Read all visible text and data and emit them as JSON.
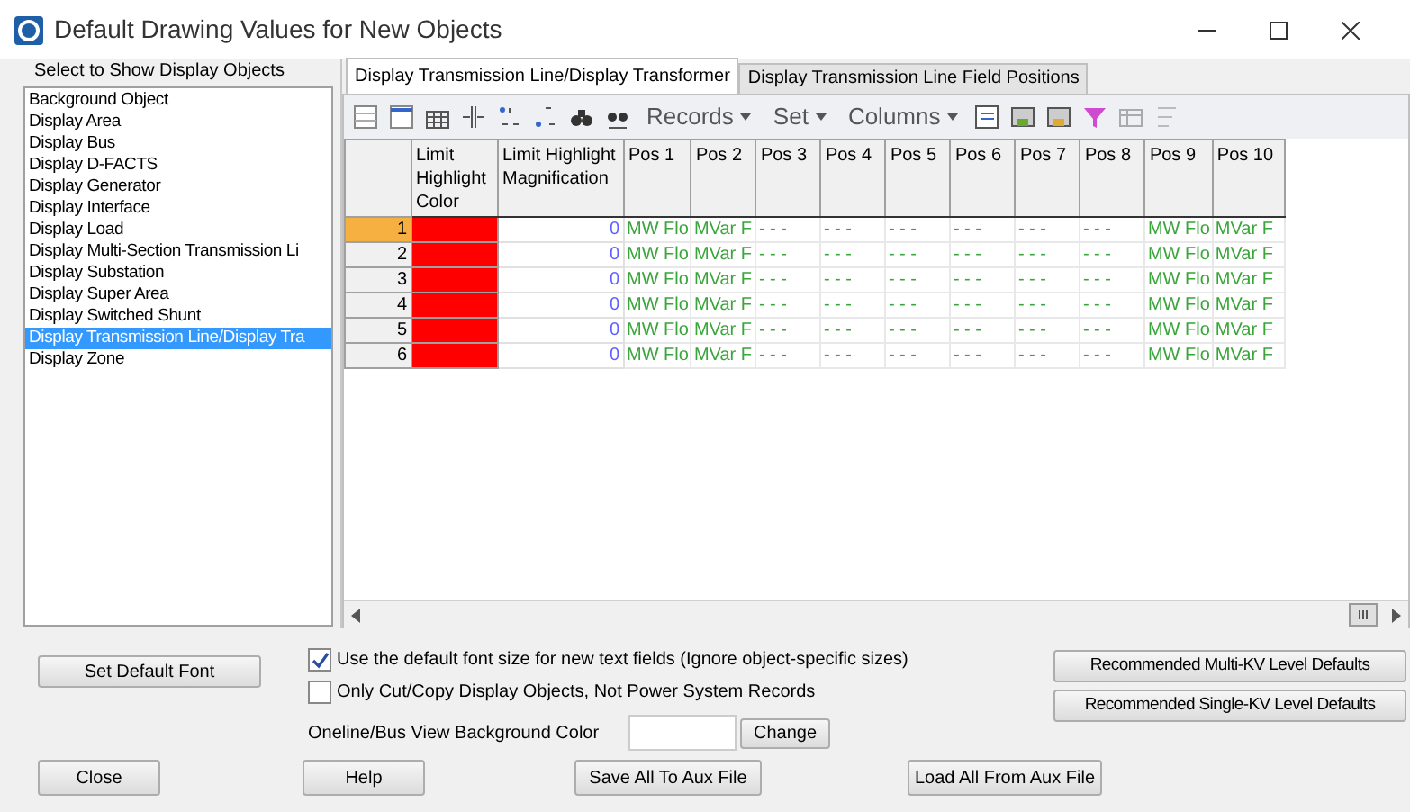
{
  "window": {
    "title": "Default Drawing Values for New Objects"
  },
  "object_list": {
    "title": "Select to Show Display Objects",
    "items": [
      {
        "label": "Background Object",
        "selected": false
      },
      {
        "label": "Display Area",
        "selected": false
      },
      {
        "label": "Display Bus",
        "selected": false
      },
      {
        "label": "Display D-FACTS",
        "selected": false
      },
      {
        "label": "Display Generator",
        "selected": false
      },
      {
        "label": "Display Interface",
        "selected": false
      },
      {
        "label": "Display Load",
        "selected": false
      },
      {
        "label": "Display Multi-Section Transmission Li",
        "selected": false
      },
      {
        "label": "Display Substation",
        "selected": false
      },
      {
        "label": "Display Super Area",
        "selected": false
      },
      {
        "label": "Display Switched Shunt",
        "selected": false
      },
      {
        "label": "Display Transmission Line/Display Tra",
        "selected": true
      },
      {
        "label": "Display Zone",
        "selected": false
      }
    ]
  },
  "tabs": [
    {
      "label": "Display Transmission Line/Display Transformer",
      "selected": true
    },
    {
      "label": "Display Transmission Line Field Positions",
      "selected": false
    }
  ],
  "toolbar": {
    "menus": [
      "Records",
      "Set",
      "Columns"
    ]
  },
  "table": {
    "columns": [
      "Limit Highlight Color",
      "Limit Highlight Magnification",
      "Pos 1",
      "Pos 2",
      "Pos 3",
      "Pos 4",
      "Pos 5",
      "Pos 6",
      "Pos 7",
      "Pos 8",
      "Pos 9",
      "Pos 10"
    ],
    "rows": [
      {
        "number": "1",
        "selected": true,
        "color": "#ff0000",
        "cells": [
          "",
          "0",
          "MW Flo",
          "MVar F",
          "- - -",
          "- - -",
          "- - -",
          "- - -",
          "- - -",
          "- - -",
          "MW Flo",
          "MVar F"
        ]
      },
      {
        "number": "2",
        "selected": false,
        "color": "#ff0000",
        "cells": [
          "",
          "0",
          "MW Flo",
          "MVar F",
          "- - -",
          "- - -",
          "- - -",
          "- - -",
          "- - -",
          "- - -",
          "MW Flo",
          "MVar F"
        ]
      },
      {
        "number": "3",
        "selected": false,
        "color": "#ff0000",
        "cells": [
          "",
          "0",
          "MW Flo",
          "MVar F",
          "- - -",
          "- - -",
          "- - -",
          "- - -",
          "- - -",
          "- - -",
          "MW Flo",
          "MVar F"
        ]
      },
      {
        "number": "4",
        "selected": false,
        "color": "#ff0000",
        "cells": [
          "",
          "0",
          "MW Flo",
          "MVar F",
          "- - -",
          "- - -",
          "- - -",
          "- - -",
          "- - -",
          "- - -",
          "MW Flo",
          "MVar F"
        ]
      },
      {
        "number": "5",
        "selected": false,
        "color": "#ff0000",
        "cells": [
          "",
          "0",
          "MW Flo",
          "MVar F",
          "- - -",
          "- - -",
          "- - -",
          "- - -",
          "- - -",
          "- - -",
          "MW Flo",
          "MVar F"
        ]
      },
      {
        "number": "6",
        "selected": false,
        "color": "#ff0000",
        "cells": [
          "",
          "0",
          "MW Flo",
          "MVar F",
          "- - -",
          "- - -",
          "- - -",
          "- - -",
          "- - -",
          "- - -",
          "MW Flo",
          "MVar F"
        ]
      }
    ]
  },
  "options": {
    "set_font_button": "Set Default Font",
    "checkboxes": [
      {
        "label": "Use the default font size for new text fields (Ignore object-specific sizes)",
        "checked": true
      },
      {
        "label": "Only Cut/Copy Display Objects, Not Power System Records",
        "checked": false
      }
    ],
    "background_color_label": "Oneline/Bus View Background Color",
    "change_button": "Change",
    "kv_buttons": [
      "Recommended Multi-KV Level Defaults",
      "Recommended Single-KV Level Defaults"
    ]
  },
  "footer_buttons": [
    "Close",
    "Help",
    "Save All To Aux File",
    "Load All From Aux File"
  ]
}
